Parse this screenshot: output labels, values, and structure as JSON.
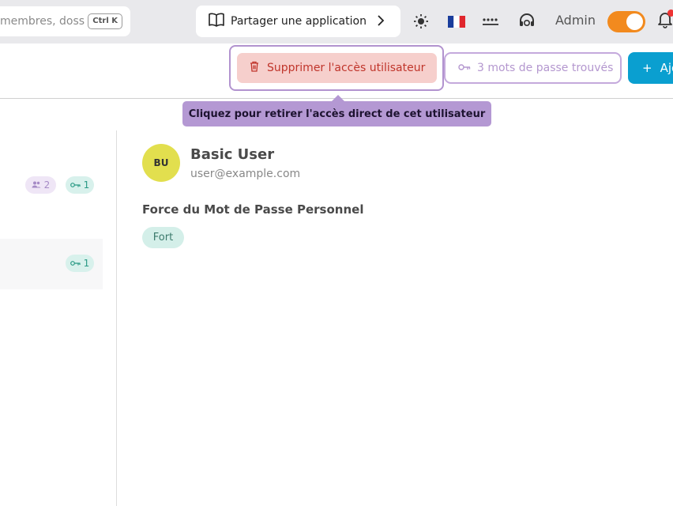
{
  "topbar": {
    "search_placeholder": "membres, doss",
    "search_shortcut": "Ctrl K",
    "share_label": "Partager une application",
    "admin_label": "Admin",
    "admin_toggle_on": true,
    "icons": [
      "book-icon",
      "chevron-right-icon",
      "sun-icon",
      "france-flag-icon",
      "password-dots-icon",
      "support-headset-icon",
      "bell-icon"
    ]
  },
  "actions": {
    "delete_access_label": "Supprimer l'accès utilisateur",
    "passwords_found_label": "3 mots de passe trouvés",
    "add_label": "Ajo",
    "add_icon": "+"
  },
  "tooltip": {
    "text": "Cliquez pour retirer l'accès direct de cet utilisateur"
  },
  "list": {
    "rows": [
      {
        "members_count": "2",
        "keys_count": "1"
      },
      {
        "keys_count": "1"
      }
    ]
  },
  "user": {
    "initials": "BU",
    "name": "Basic User",
    "email": "user@example.com",
    "password_strength_title": "Force du Mot de Passe Personnel",
    "password_strength_value": "Fort"
  },
  "colors": {
    "accent": "#0a9fd0",
    "danger": "#c0352b",
    "tooltip": "#b498d3",
    "toggle": "#f28a1e",
    "avatar": "#e2df4e"
  }
}
